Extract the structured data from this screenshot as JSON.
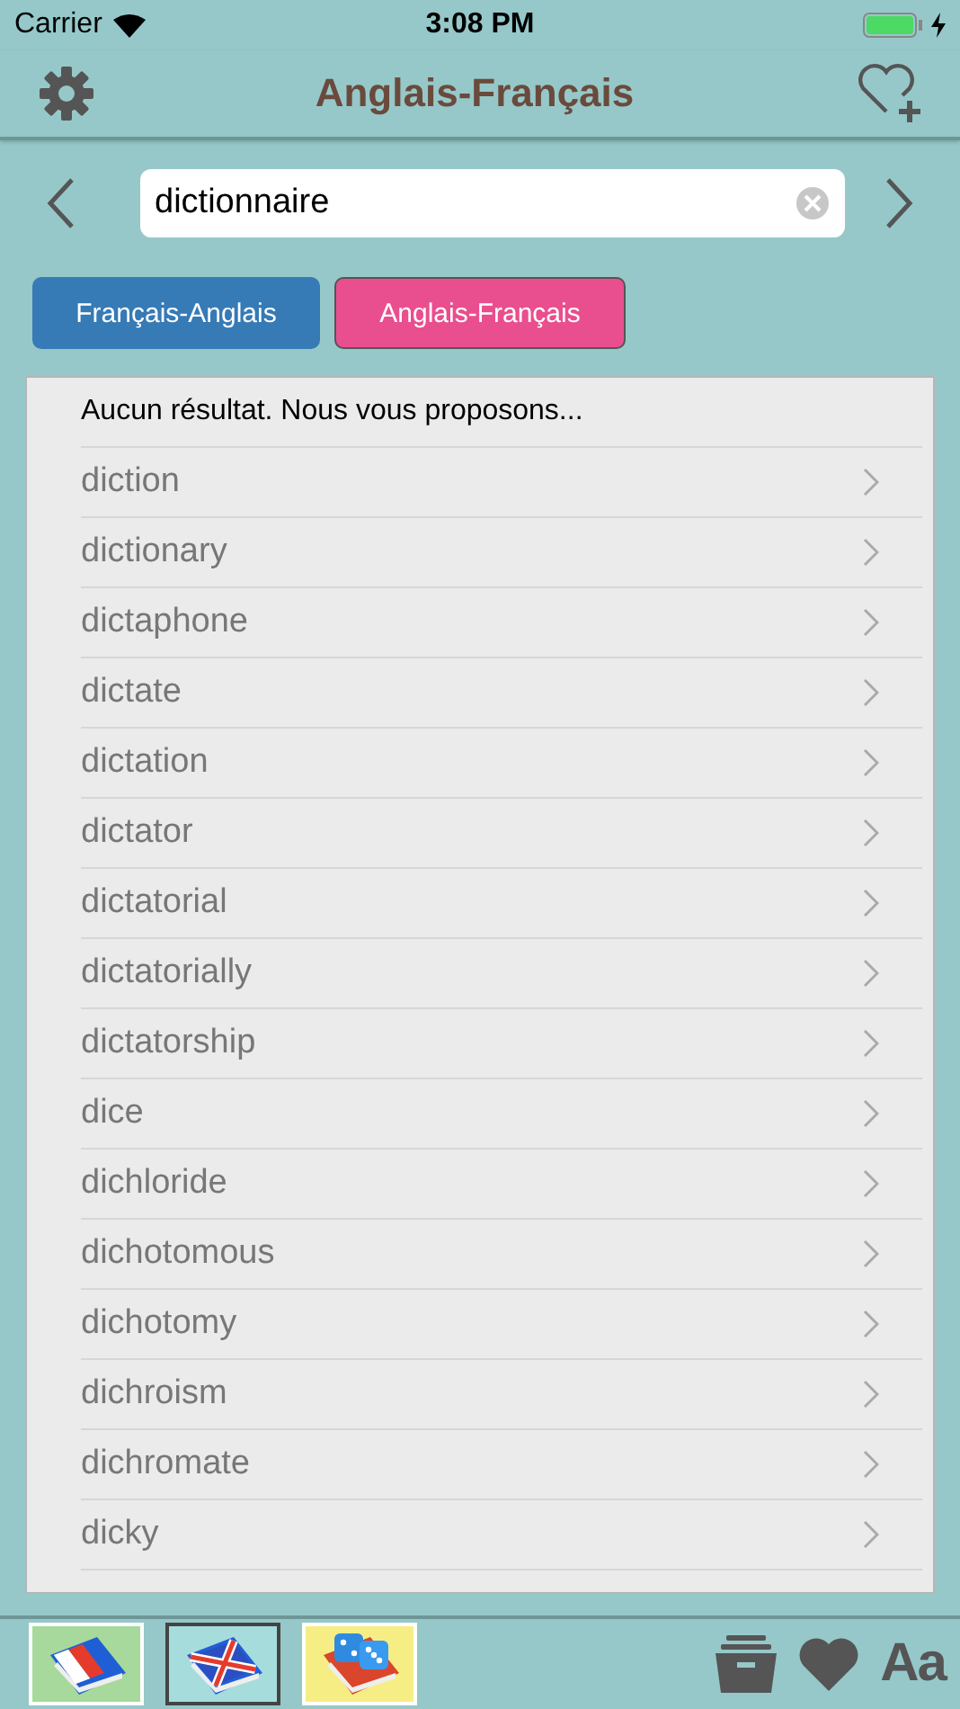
{
  "status_bar": {
    "carrier": "Carrier",
    "time": "3:08 PM"
  },
  "nav": {
    "title": "Anglais-Français"
  },
  "search": {
    "value": "dictionnaire"
  },
  "tabs": [
    {
      "label": "Français-Anglais",
      "selected": false
    },
    {
      "label": "Anglais-Français",
      "selected": true
    }
  ],
  "results": {
    "header": "Aucun résultat. Nous vous proposons...",
    "items": [
      "diction",
      "dictionary",
      "dictaphone",
      "dictate",
      "dictation",
      "dictator",
      "dictatorial",
      "dictatorially",
      "dictatorship",
      "dice",
      "dichloride",
      "dichotomous",
      "dichotomy",
      "dichroism",
      "dichromate",
      "dicky"
    ]
  },
  "bottom_bar": {
    "tiles": [
      {
        "kind": "french",
        "selected": false
      },
      {
        "kind": "english",
        "selected": true
      },
      {
        "kind": "game",
        "selected": false
      }
    ],
    "font_button": "Aa"
  }
}
